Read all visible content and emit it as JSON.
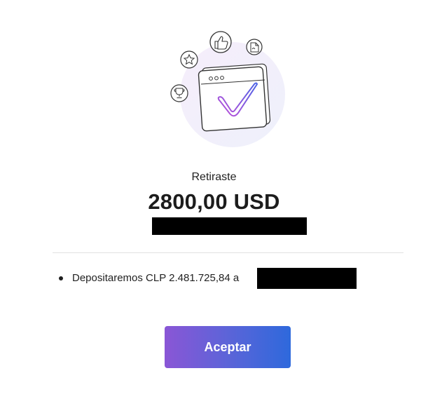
{
  "illustration": {
    "icons": [
      "browser-window-icon",
      "checkmark-icon",
      "thumbs-up-icon",
      "star-icon",
      "trophy-icon",
      "document-icon"
    ],
    "colors": {
      "halo": "#f1eefb",
      "line": "#333333",
      "check_start": "#c44fd8",
      "check_end": "#4a63e6"
    }
  },
  "result": {
    "title": "Retiraste",
    "amount": "2800,00 USD"
  },
  "details": [
    {
      "text": "Depositaremos CLP 2.481.725,84 a"
    }
  ],
  "actions": {
    "accept_label": "Aceptar"
  },
  "colors": {
    "button_gradient_start": "#8a56d6",
    "button_gradient_end": "#2e69dc",
    "divider": "#e1e1e1",
    "redaction": "#000000"
  }
}
